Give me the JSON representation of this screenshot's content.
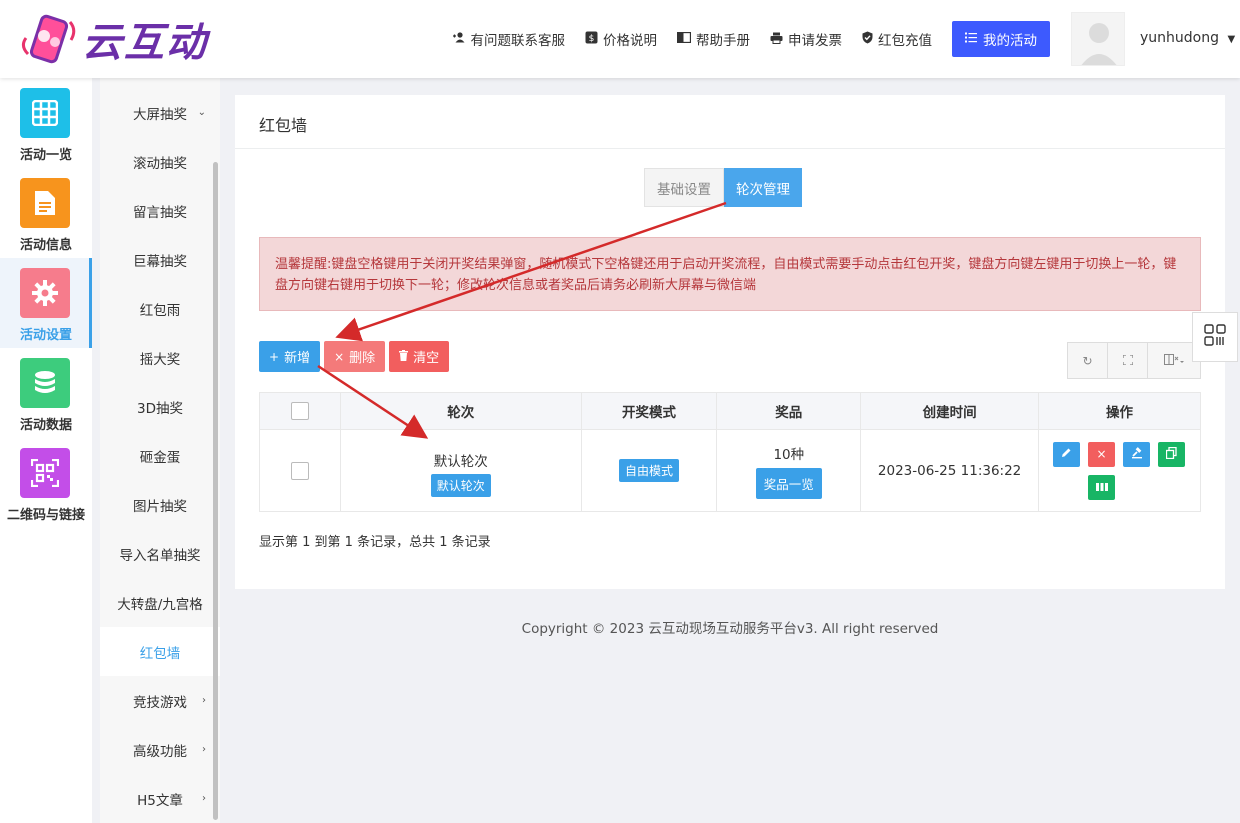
{
  "header": {
    "logo_text": "云互动",
    "nav": [
      {
        "label": "有问题联系客服",
        "icon": "user-plus-icon"
      },
      {
        "label": "价格说明",
        "icon": "dollar-icon"
      },
      {
        "label": "帮助手册",
        "icon": "book-icon"
      },
      {
        "label": "申请发票",
        "icon": "printer-icon"
      },
      {
        "label": "红包充值",
        "icon": "shield-check-icon"
      }
    ],
    "my_activity": "我的活动",
    "username": "yunhudong"
  },
  "rail": [
    {
      "label": "活动一览",
      "icon": "grid-icon",
      "color": "#1ebfe8"
    },
    {
      "label": "活动信息",
      "icon": "document-icon",
      "color": "#f7941d"
    },
    {
      "label": "活动设置",
      "icon": "gear-icon",
      "color": "#f67c8c",
      "active": true
    },
    {
      "label": "活动数据",
      "icon": "database-icon",
      "color": "#3dcc7d"
    },
    {
      "label": "二维码与链接",
      "icon": "qrcode-icon",
      "color": "#c34ee8"
    }
  ],
  "submenu": [
    {
      "label": "大屏抽奖",
      "chevron": "down"
    },
    {
      "label": "滚动抽奖"
    },
    {
      "label": "留言抽奖"
    },
    {
      "label": "巨幕抽奖"
    },
    {
      "label": "红包雨"
    },
    {
      "label": "摇大奖"
    },
    {
      "label": "3D抽奖"
    },
    {
      "label": "砸金蛋"
    },
    {
      "label": "图片抽奖"
    },
    {
      "label": "导入名单抽奖"
    },
    {
      "label": "大转盘/九宫格"
    },
    {
      "label": "红包墙",
      "active": true
    },
    {
      "label": "竞技游戏",
      "chevron": "right"
    },
    {
      "label": "高级功能",
      "chevron": "right"
    },
    {
      "label": "H5文章",
      "chevron": "right"
    }
  ],
  "panel": {
    "title": "红包墙",
    "tabs": [
      "基础设置",
      "轮次管理"
    ],
    "alert": "温馨提醒:键盘空格键用于关闭开奖结果弹窗，随机模式下空格键还用于启动开奖流程，自由模式需要手动点击红包开奖，键盘方向键左键用于切换上一轮，键盘方向键右键用于切换下一轮；修改轮次信息或者奖品后请务必刷新大屏幕与微信端",
    "toolbar": {
      "add": "新增",
      "delete": "删除",
      "clear": "清空"
    },
    "table": {
      "headers": [
        "轮次",
        "开奖模式",
        "奖品",
        "创建时间",
        "操作"
      ],
      "rows": [
        {
          "round": "默认轮次",
          "round_tag": "默认轮次",
          "mode": "自由模式",
          "prize_count": "10种",
          "prize_btn": "奖品一览",
          "created": "2023-06-25 11:36:22"
        }
      ]
    },
    "summary": "显示第 1 到第 1 条记录，总共 1 条记录"
  },
  "footer": "Copyright © 2023 云互动现场互动服务平台v3. All right reserved",
  "colors": {
    "accent": "#3aa0e8",
    "primary_nav": "#3d5afe",
    "danger": "#f25e5e",
    "success": "#18b565",
    "alert_bg": "#f3d7d8",
    "arrow": "#d42a2a"
  }
}
